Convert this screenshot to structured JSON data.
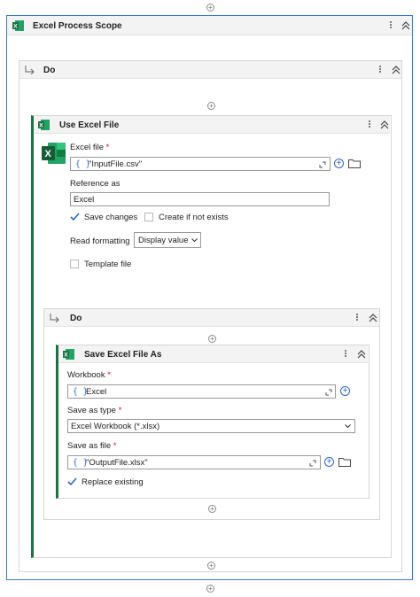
{
  "scope": {
    "title": "Excel Process Scope",
    "do_label": "Do"
  },
  "use_excel": {
    "title": "Use Excel File",
    "excel_file_label": "Excel file",
    "excel_file_value": "\"InputFile.csv\"",
    "reference_label": "Reference as",
    "reference_value": "Excel",
    "save_changes": "Save changes",
    "create_if_not_exists": "Create if not exists",
    "read_formatting_label": "Read formatting",
    "read_formatting_value": "Display value",
    "template_file": "Template file",
    "do_label": "Do"
  },
  "save_as": {
    "title": "Save Excel File As",
    "workbook_label": "Workbook",
    "workbook_value": "Excel",
    "save_type_label": "Save as type",
    "save_type_value": "Excel Workbook (*.xlsx)",
    "save_file_label": "Save as file",
    "save_file_value": "\"OutputFile.xlsx\"",
    "replace_existing": "Replace existing"
  },
  "required_mark": "*",
  "braces": "{ }",
  "icons": {
    "add": "plus-circle-icon",
    "kebab": "more-vertical-icon",
    "collapse": "double-chevron-up-icon",
    "excel": "excel-icon",
    "expand": "expand-editor-icon",
    "folder": "folder-icon",
    "dropdown": "chevron-down-icon",
    "do_arrow": "return-arrow-icon"
  },
  "colors": {
    "accent": "#2d66c9",
    "excel_green": "#1e7145",
    "frame_blue": "#3a78d4"
  }
}
